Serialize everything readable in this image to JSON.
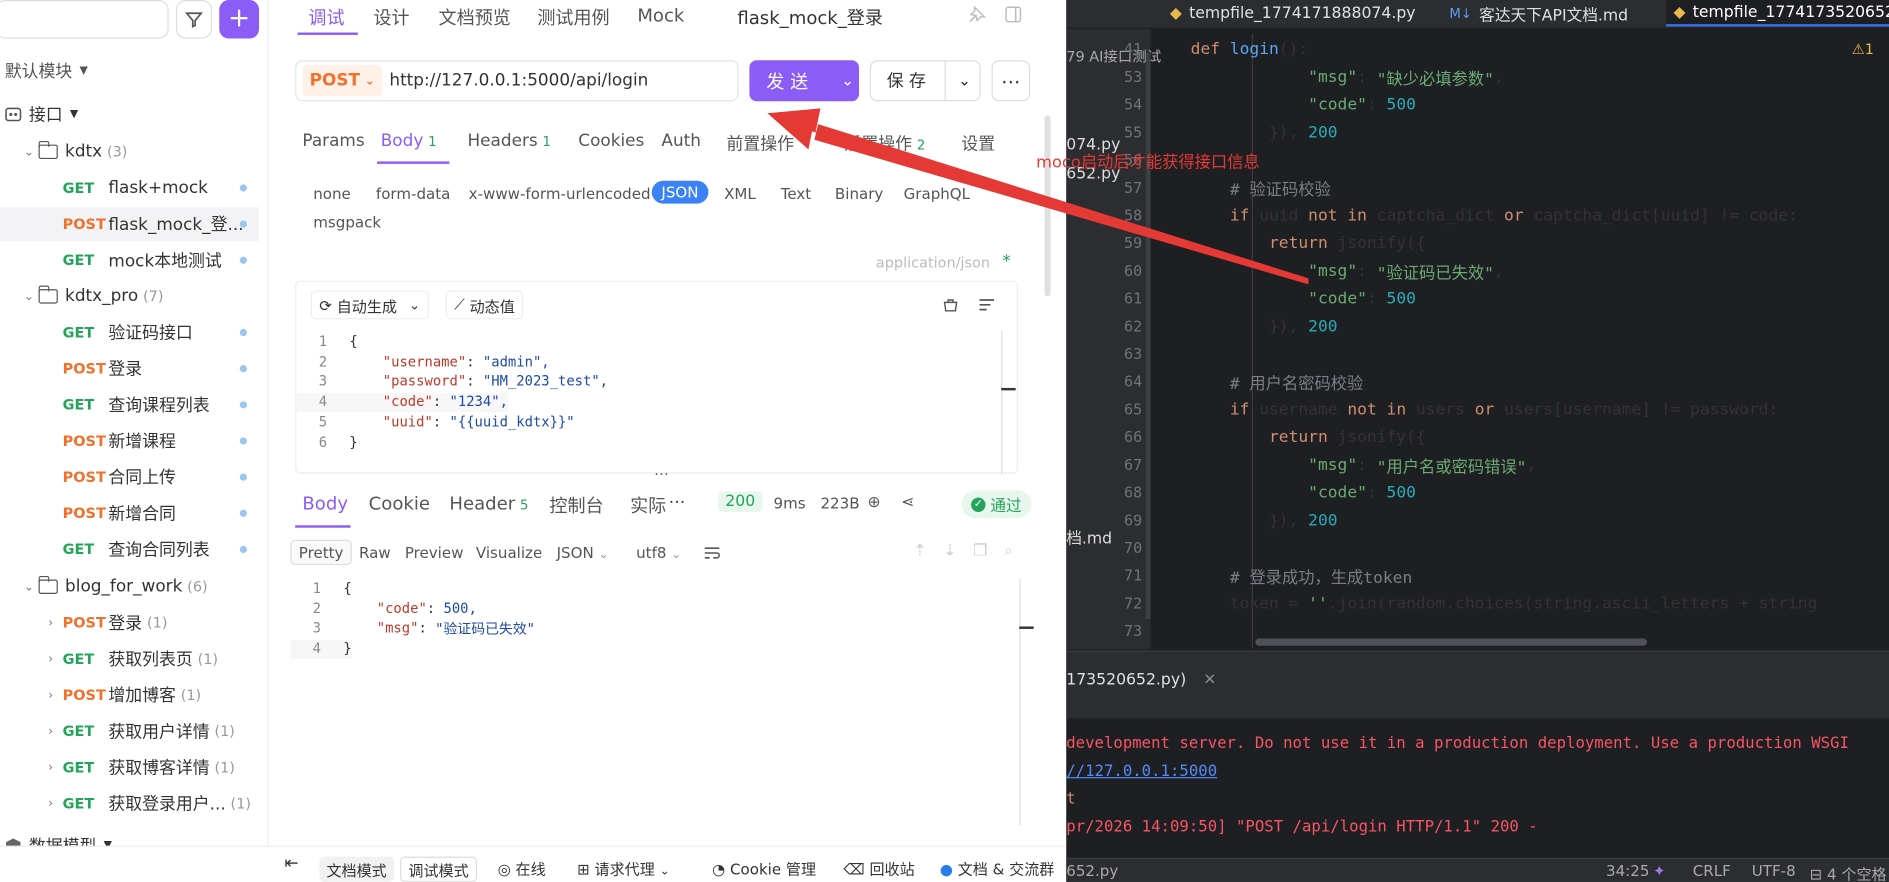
{
  "sidebar": {
    "sections": {
      "modules": "默认模块",
      "api": "接口",
      "data_model": "数据模型"
    },
    "folders": [
      {
        "name": "kdtx",
        "count": "(3)"
      },
      {
        "name": "kdtx_pro",
        "count": "(7)"
      },
      {
        "name": "blog_for_work",
        "count": "(6)"
      }
    ],
    "kdtx_items": [
      {
        "method": "GET",
        "name": "flask+mock"
      },
      {
        "method": "POST",
        "name": "flask_mock_登..."
      },
      {
        "method": "GET",
        "name": "mock本地测试"
      }
    ],
    "kdtx_pro_items": [
      {
        "method": "GET",
        "name": "验证码接口"
      },
      {
        "method": "POST",
        "name": "登录"
      },
      {
        "method": "GET",
        "name": "查询课程列表"
      },
      {
        "method": "POST",
        "name": "新增课程"
      },
      {
        "method": "POST",
        "name": "合同上传"
      },
      {
        "method": "POST",
        "name": "新增合同"
      },
      {
        "method": "GET",
        "name": "查询合同列表"
      }
    ],
    "blog_items": [
      {
        "method": "POST",
        "name": "登录",
        "count": "(1)"
      },
      {
        "method": "GET",
        "name": "获取列表页",
        "count": "(1)"
      },
      {
        "method": "POST",
        "name": "增加博客",
        "count": "(1)"
      },
      {
        "method": "GET",
        "name": "获取用户详情",
        "count": "(1)"
      },
      {
        "method": "GET",
        "name": "获取博客详情",
        "count": "(1)"
      },
      {
        "method": "GET",
        "name": "获取登录用户...",
        "count": "(1)"
      }
    ]
  },
  "top_tabs": [
    "调试",
    "设计",
    "文档预览",
    "测试用例",
    "Mock"
  ],
  "api_title": "flask_mock_登录",
  "request": {
    "method": "POST",
    "url": "http://127.0.0.1:5000/api/login",
    "send_label": "发 送",
    "save_label": "保 存"
  },
  "req_tabs": {
    "params": "Params",
    "body": "Body",
    "body_count": "1",
    "headers": "Headers",
    "headers_count": "1",
    "cookies": "Cookies",
    "auth": "Auth",
    "pre": "前置操作",
    "post": "后置操作",
    "post_count": "2",
    "settings": "设置"
  },
  "body_types": [
    "none",
    "form-data",
    "x-www-form-urlencoded",
    "JSON",
    "XML",
    "Text",
    "Binary",
    "GraphQL",
    "msgpack"
  ],
  "content_type": "application/json",
  "required_star": "*",
  "editor_tools": {
    "auto_gen": "自动生成",
    "dynamic": "动态值"
  },
  "request_body": [
    {
      "n": "1",
      "text": "{"
    },
    {
      "n": "2",
      "key": "\"username\"",
      "val": "\"admin\","
    },
    {
      "n": "3",
      "key": "\"password\"",
      "val": "\"HM_2023_test\","
    },
    {
      "n": "4",
      "key": "\"code\"",
      "val": "\"1234\","
    },
    {
      "n": "5",
      "key": "\"uuid\"",
      "val": "\"{{uuid_kdtx}}\""
    },
    {
      "n": "6",
      "text": "}"
    }
  ],
  "resp_tabs": {
    "body": "Body",
    "cookie": "Cookie",
    "header": "Header",
    "header_count": "5",
    "console": "控制台",
    "actual": "实际",
    "status": "200",
    "time": "9ms",
    "size": "223B",
    "pass": "通过"
  },
  "resp_formats": [
    "Pretty",
    "Raw",
    "Preview",
    "Visualize",
    "JSON",
    "utf8"
  ],
  "response_body": [
    {
      "n": "1",
      "text": "{"
    },
    {
      "n": "2",
      "key": "\"code\"",
      "val": "500,"
    },
    {
      "n": "3",
      "key": "\"msg\"",
      "val": "\"验证码已失效\""
    },
    {
      "n": "4",
      "text": "}"
    }
  ],
  "bottom_bar": {
    "collapse": "⇤",
    "doc_mode": "文档模式",
    "debug_mode": "调试模式",
    "online": "在线",
    "proxy": "请求代理",
    "cookie": "Cookie 管理",
    "recycle": "回收站",
    "docs": "文档 & 交流群"
  },
  "annotation": "moco启动后才能获得接口信息",
  "ide": {
    "tabs": [
      "tempfile_1774171888074.py",
      "客达天下API文档.md",
      "tempfile_1774173520652.py"
    ],
    "left_peek": [
      "79 AI接口测试",
      "074.py",
      "652.py",
      "档.md"
    ],
    "warning": "⚠1",
    "code": [
      {
        "n": "41",
        "t": [
          [
            "kw",
            "def "
          ],
          [
            "fn",
            "login"
          ],
          [
            "p",
            "():"
          ]
        ],
        "indent": 0
      },
      {
        "n": "53",
        "t": [
          [
            "str",
            "\"msg\""
          ],
          [
            "p",
            ": "
          ],
          [
            "str",
            "\"缺少必填参数\""
          ],
          [
            "p",
            ","
          ]
        ],
        "indent": 3
      },
      {
        "n": "54",
        "t": [
          [
            "str",
            "\"code\""
          ],
          [
            "p",
            ": "
          ],
          [
            "num",
            "500"
          ]
        ],
        "indent": 3
      },
      {
        "n": "55",
        "t": [
          [
            "p",
            "}), "
          ],
          [
            "num",
            "200"
          ]
        ],
        "indent": 2
      },
      {
        "n": "56",
        "t": [],
        "indent": 0
      },
      {
        "n": "57",
        "t": [
          [
            "cm",
            "# 验证码校验"
          ]
        ],
        "indent": 1
      },
      {
        "n": "58",
        "t": [
          [
            "kw",
            "if "
          ],
          [
            "p",
            "uuid "
          ],
          [
            "kw",
            "not in "
          ],
          [
            "p",
            "captcha_dict "
          ],
          [
            "kw",
            "or "
          ],
          [
            "p",
            "captcha_dict[uuid] != code:"
          ]
        ],
        "indent": 1
      },
      {
        "n": "59",
        "t": [
          [
            "kw",
            "return "
          ],
          [
            "p",
            "jsonify({"
          ]
        ],
        "indent": 2
      },
      {
        "n": "60",
        "t": [
          [
            "str",
            "\"msg\""
          ],
          [
            "p",
            ": "
          ],
          [
            "str",
            "\"验证码已失效\""
          ],
          [
            "p",
            ","
          ]
        ],
        "indent": 3
      },
      {
        "n": "61",
        "t": [
          [
            "str",
            "\"code\""
          ],
          [
            "p",
            ": "
          ],
          [
            "num",
            "500"
          ]
        ],
        "indent": 3
      },
      {
        "n": "62",
        "t": [
          [
            "p",
            "}), "
          ],
          [
            "num",
            "200"
          ]
        ],
        "indent": 2
      },
      {
        "n": "63",
        "t": [],
        "indent": 0
      },
      {
        "n": "64",
        "t": [
          [
            "cm",
            "# 用户名密码校验"
          ]
        ],
        "indent": 1
      },
      {
        "n": "65",
        "t": [
          [
            "kw",
            "if "
          ],
          [
            "p",
            "username "
          ],
          [
            "kw",
            "not in "
          ],
          [
            "p",
            "users "
          ],
          [
            "kw",
            "or "
          ],
          [
            "p",
            "users[username] != password:"
          ]
        ],
        "indent": 1
      },
      {
        "n": "66",
        "t": [
          [
            "kw",
            "return "
          ],
          [
            "p",
            "jsonify({"
          ]
        ],
        "indent": 2
      },
      {
        "n": "67",
        "t": [
          [
            "str",
            "\"msg\""
          ],
          [
            "p",
            ": "
          ],
          [
            "str",
            "\"用户名或密码错误\""
          ],
          [
            "p",
            ","
          ]
        ],
        "indent": 3
      },
      {
        "n": "68",
        "t": [
          [
            "str",
            "\"code\""
          ],
          [
            "p",
            ": "
          ],
          [
            "num",
            "500"
          ]
        ],
        "indent": 3
      },
      {
        "n": "69",
        "t": [
          [
            "p",
            "}), "
          ],
          [
            "num",
            "200"
          ]
        ],
        "indent": 2
      },
      {
        "n": "70",
        "t": [],
        "indent": 0
      },
      {
        "n": "71",
        "t": [
          [
            "cm",
            "# 登录成功，生成token"
          ]
        ],
        "indent": 1
      },
      {
        "n": "72",
        "t": [
          [
            "p",
            "token = "
          ],
          [
            "str",
            "''"
          ],
          [
            "p",
            ".join(random.choices(string.ascii_letters + string"
          ]
        ],
        "indent": 1
      },
      {
        "n": "73",
        "t": [],
        "indent": 0
      }
    ],
    "run_tab": "173520652.py)",
    "terminal": [
      {
        "text": "development server. Do not use it in a production deployment. Use a production WSGI",
        "color": "#f75464"
      },
      {
        "text": "//127.0.0.1:5000",
        "color": "#548af7"
      },
      {
        "text": "t",
        "color": "#cf8e6d"
      },
      {
        "text": "pr/2026 14:09:50] \"POST /api/login HTTP/1.1\" 200 -",
        "color": "#f75464"
      }
    ],
    "status": {
      "file": "652.py",
      "pos": "34:25",
      "eol": "CRLF",
      "enc": "UTF-8",
      "indent": "4 个空格"
    }
  },
  "colors": {
    "accent": "#8b5cf6",
    "get": "#22a55a",
    "post": "#f0712c",
    "arrow": "#e53935"
  }
}
